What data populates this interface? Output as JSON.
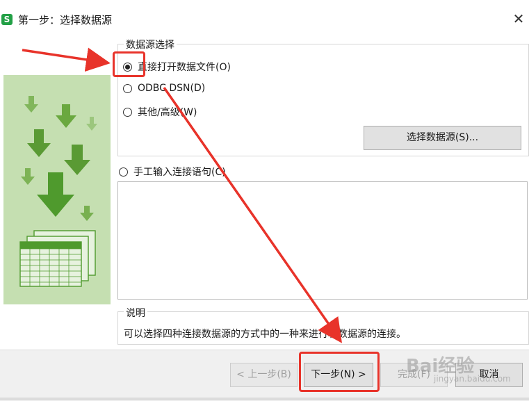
{
  "window": {
    "title": "第一步：选择数据源",
    "close_glyph": "✕",
    "app_icon_letter": "S"
  },
  "data_source_group": {
    "legend": "数据源选择",
    "options": [
      {
        "label": "直接打开数据文件(O)",
        "checked": true
      },
      {
        "label": "ODBC DSN(D)",
        "checked": false
      },
      {
        "label": "其他/高级(W)",
        "checked": false
      }
    ],
    "select_button": "选择数据源(S)..."
  },
  "manual_option": {
    "label": "手工输入连接语句(C)",
    "checked": false
  },
  "connection_text": {
    "value": ""
  },
  "description": {
    "legend": "说明",
    "text": "可以选择四种连接数据源的方式中的一种来进行和数据源的连接。"
  },
  "footer": {
    "prev_button": "< 上一步(B)",
    "next_button": "下一步(N) >",
    "finish_button": "完成(F)",
    "cancel_button": "取消"
  },
  "watermark": {
    "brand": "Bai经验",
    "url": "jingyan.baidu.com"
  },
  "colors": {
    "banner_bg": "#c5dfb1",
    "arrow_green": "#4f9a2d",
    "annotation_red": "#e8332a",
    "app_icon_green": "#22a046"
  },
  "icons": [
    "app-logo-icon",
    "close-icon",
    "download-arrows-illustration",
    "spreadsheet-illustration",
    "scroll-up-icon",
    "scroll-down-icon"
  ]
}
